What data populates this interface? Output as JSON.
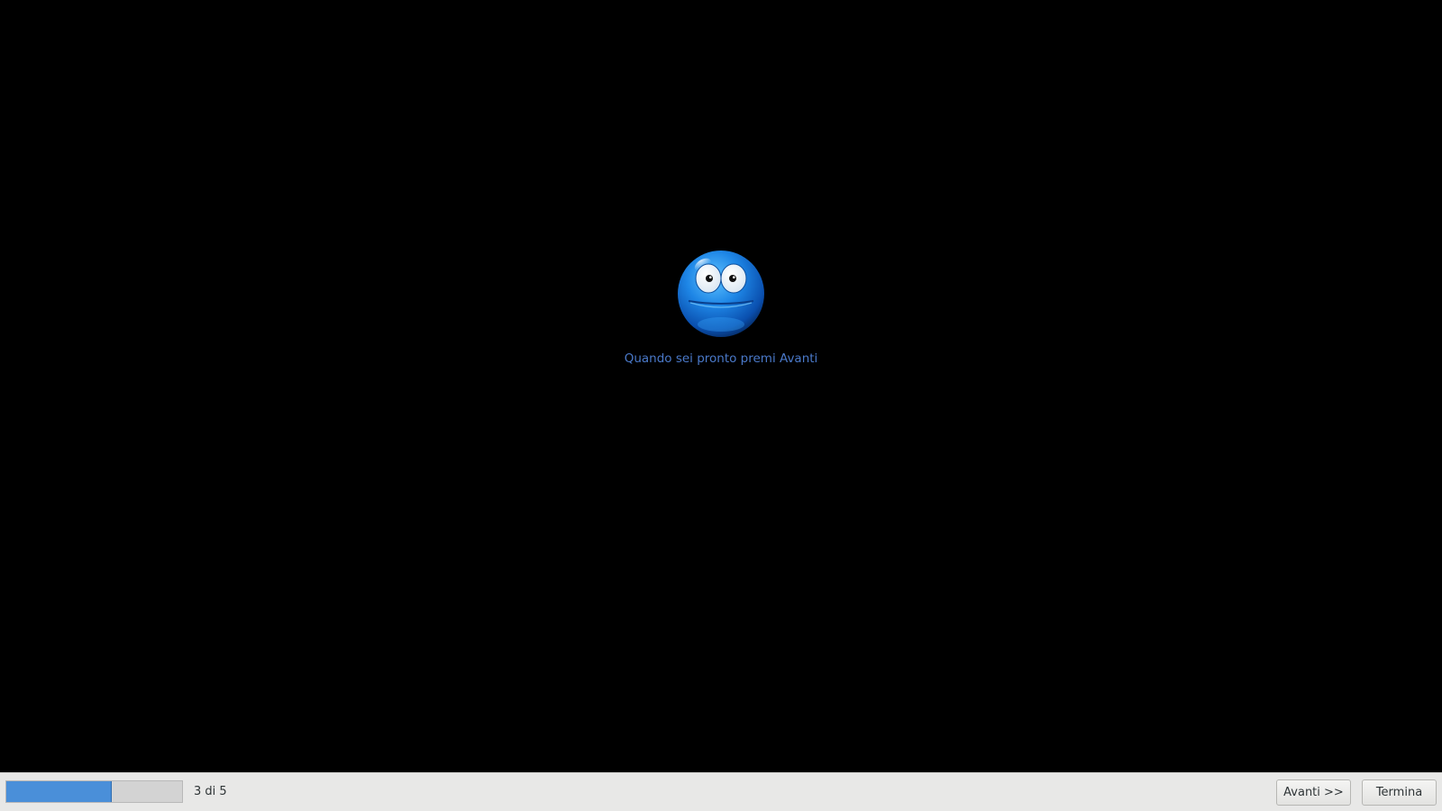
{
  "main": {
    "mascot_icon": "blue-smiley-face-icon",
    "prompt_text": "Quando sei pronto premi Avanti"
  },
  "footer": {
    "progress": {
      "current_step": 3,
      "total_steps": 5,
      "fill_fraction": 0.6,
      "label": "3 di 5"
    },
    "next_button_label": "Avanti >>",
    "finish_button_label": "Termina"
  },
  "colors": {
    "background": "#000000",
    "prompt_text": "#4a79c9",
    "progress_fill": "#4a8fd9",
    "footer_bg": "#e8e8e7"
  }
}
